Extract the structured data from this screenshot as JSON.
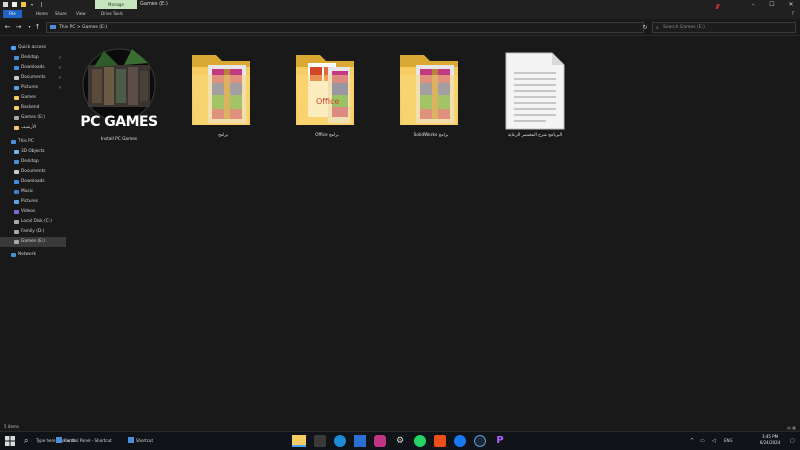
{
  "titlebar": {
    "manage_tab": "Manage",
    "title": "Games (E:)",
    "minimize": "–",
    "maximize": "☐",
    "close": "✕"
  },
  "ribbon": {
    "tabs": [
      "File",
      "Home",
      "Share",
      "View",
      "Drive Tools"
    ],
    "help": "?"
  },
  "addressbar": {
    "path": "This PC  >  Games (E:)",
    "search_placeholder": "Search Games (E:)"
  },
  "navpane": {
    "quick_access": "Quick access",
    "items": [
      {
        "label": "Desktop",
        "pinned": "✓"
      },
      {
        "label": "Downloads",
        "pinned": "✓"
      },
      {
        "label": "Documents",
        "pinned": "✓"
      },
      {
        "label": "Pictures",
        "pinned": "✓"
      },
      {
        "label": "Games",
        "pinned": ""
      },
      {
        "label": "Backend",
        "pinned": ""
      },
      {
        "label": "Games (E:)",
        "pinned": ""
      },
      {
        "label": "الأرشيف",
        "pinned": ""
      }
    ],
    "this_pc": "This PC",
    "pc_items": [
      {
        "label": "3D Objects"
      },
      {
        "label": "Desktop"
      },
      {
        "label": "Documents"
      },
      {
        "label": "Downloads"
      },
      {
        "label": "Music"
      },
      {
        "label": "Pictures"
      },
      {
        "label": "Videos"
      },
      {
        "label": "Local Disk (C:)"
      },
      {
        "label": "Family (D:)"
      },
      {
        "label": "Games (E:)"
      }
    ],
    "network": "Network"
  },
  "content": {
    "items": [
      {
        "name": "Install PC Games",
        "type": "pc-games-app-icon",
        "badge_text": "PC GAMES"
      },
      {
        "name": "برامج",
        "type": "rar-folder-icon"
      },
      {
        "name": "Office برامج",
        "type": "office-folder-icon",
        "badge_text": "Office"
      },
      {
        "name": "SolidWorks برامج",
        "type": "rar-folder-icon"
      },
      {
        "name": "البرنامج شرح المختصر الرعاية",
        "type": "text-document-icon"
      }
    ]
  },
  "statusbar": {
    "count": "5 items"
  },
  "taskbar": {
    "search_text": "Type here to search",
    "windows": [
      "Control Panel - Shortcut",
      "Shortcut"
    ],
    "time": "3:45 PM",
    "date": "6/24/2024",
    "lang": "ENG"
  },
  "colors": {
    "accent": "#1f64c4",
    "manage_tab": "#c7e6bf",
    "folder": "#f6cd63",
    "background": "#191919"
  }
}
